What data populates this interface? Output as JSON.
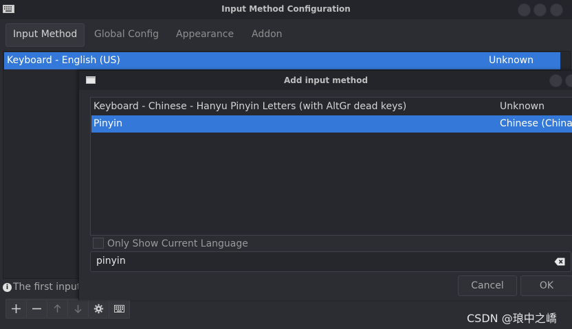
{
  "main_window": {
    "title": "Input Method Configuration",
    "tabs": [
      {
        "label": "Input Method"
      },
      {
        "label": "Global Config"
      },
      {
        "label": "Appearance"
      },
      {
        "label": "Addon"
      }
    ],
    "input_methods": [
      {
        "name": "Keyboard - English (US)",
        "language": "Unknown"
      }
    ],
    "info_text": "The first input"
  },
  "dialog": {
    "title": "Add input method",
    "items": [
      {
        "name": "Keyboard - Chinese - Hanyu Pinyin Letters (with AltGr dead keys)",
        "language": "Unknown",
        "selected": false
      },
      {
        "name": "Pinyin",
        "language": "Chinese (China)",
        "selected": true
      }
    ],
    "only_show_current_language": {
      "label": "Only Show Current Language",
      "checked": false
    },
    "search": {
      "value": "pinyin"
    },
    "cancel_label": "Cancel",
    "ok_label": "OK"
  },
  "watermark": "CSDN @琅中之嶠",
  "colors": {
    "selection": "#3479d9",
    "background": "#2b2d33",
    "titlebar": "#23252a"
  },
  "icons": {
    "window": "keyboard-icon",
    "toolbar": [
      "add-icon",
      "remove-icon",
      "arrow-up-icon",
      "arrow-down-icon",
      "gear-icon",
      "keyboard-icon"
    ]
  }
}
